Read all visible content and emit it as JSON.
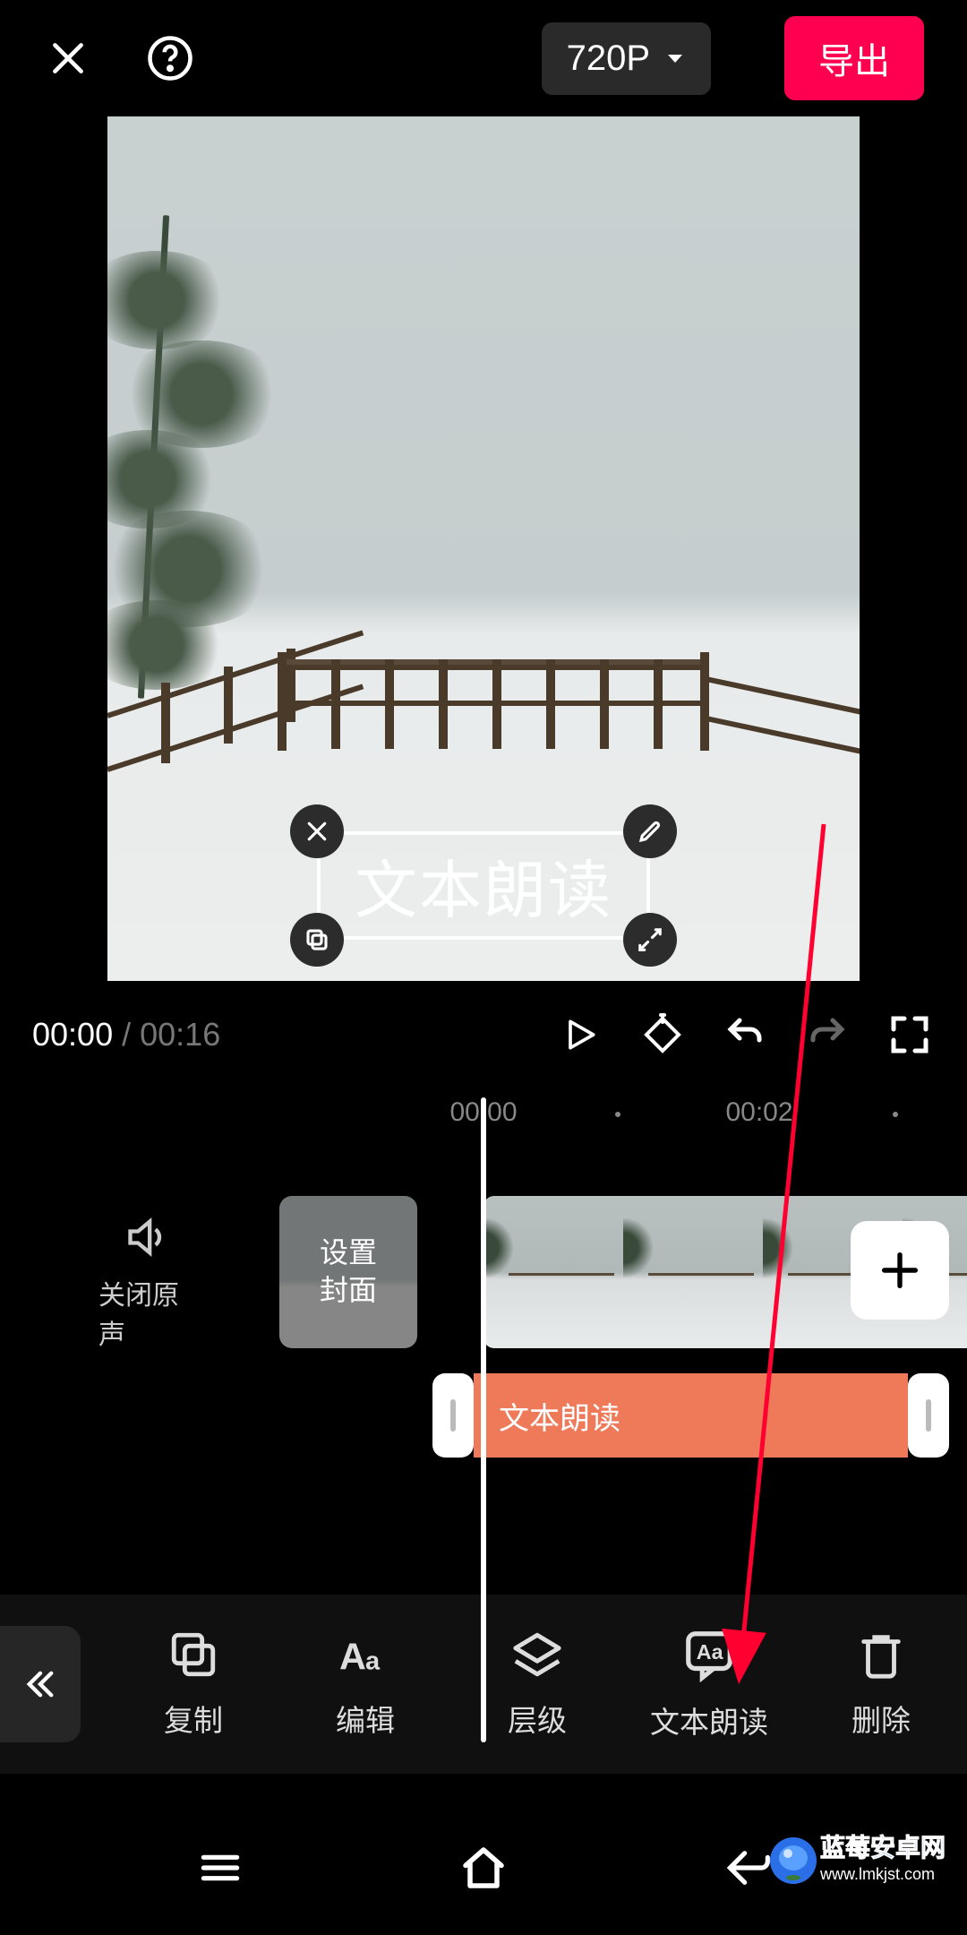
{
  "header": {
    "resolution_label": "720P",
    "export_label": "导出"
  },
  "preview": {
    "overlay_text": "文本朗读"
  },
  "playback": {
    "current_time": "00:00",
    "total_time": "00:16"
  },
  "timeline": {
    "ruler_marks": [
      "00:00",
      "00:02"
    ],
    "mute_label": "关闭原声",
    "cover_label": "设置\n封面",
    "text_clip_label": "文本朗读"
  },
  "toolbar": {
    "items": [
      {
        "id": "copy",
        "label": "复制"
      },
      {
        "id": "edit",
        "label": "编辑"
      },
      {
        "id": "layer",
        "label": "层级"
      },
      {
        "id": "tts",
        "label": "文本朗读"
      },
      {
        "id": "delete",
        "label": "删除"
      }
    ]
  },
  "watermark": {
    "title": "蓝莓安卓网",
    "url": "www.lmkjst.com"
  }
}
